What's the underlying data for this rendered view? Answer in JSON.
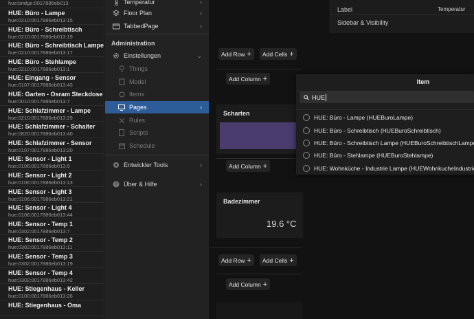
{
  "things_list": [
    {
      "title": "",
      "subtitle": "hue:bridge:0017886eb013"
    },
    {
      "title": "HUE: Büro - Lampe",
      "subtitle": "hue:0210:0017886eb013:15"
    },
    {
      "title": "HUE: Büro - Schreibtisch",
      "subtitle": "hue:0210:0017886eb013:19"
    },
    {
      "title": "HUE: Büro - Schreibtisch Lampe",
      "subtitle": "hue:0210:0017886eb013:17"
    },
    {
      "title": "HUE: Büro - Stehlampe",
      "subtitle": "hue:0210:0017886eb013:1"
    },
    {
      "title": "HUE: Eingang - Sensor",
      "subtitle": "hue:0107:0017886eb013:43"
    },
    {
      "title": "HUE: Garten - Osram Steckdose",
      "subtitle": "hue:0010:0017886eb013:7"
    },
    {
      "title": "HUE: Schlafzimmer - Lampe",
      "subtitle": "hue:0210:0017886eb013:29"
    },
    {
      "title": "HUE: Schlafzimmer - Schalter",
      "subtitle": "hue:0820:0017886eb013:40"
    },
    {
      "title": "HUE: Schlafzimmer - Sensor",
      "subtitle": "hue:0107:0017886eb013:20"
    },
    {
      "title": "HUE: Sensor - Light 1",
      "subtitle": "hue:0106:0017886eb013:9"
    },
    {
      "title": "HUE: Sensor - Light 2",
      "subtitle": "hue:0106:0017886eb013:13"
    },
    {
      "title": "HUE: Sensor - Light 3",
      "subtitle": "hue:0106:0017886eb013:21"
    },
    {
      "title": "HUE: Sensor - Light 4",
      "subtitle": "hue:0106:0017886eb013:44"
    },
    {
      "title": "HUE: Sensor - Temp 1",
      "subtitle": "hue:0302:0017886eb013:7"
    },
    {
      "title": "HUE: Sensor - Temp 2",
      "subtitle": "hue:0302:0017886eb013:11"
    },
    {
      "title": "HUE: Sensor - Temp 3",
      "subtitle": "hue:0302:0017886eb013:19"
    },
    {
      "title": "HUE: Sensor - Temp 4",
      "subtitle": "hue:0302:0017886eb013:42"
    },
    {
      "title": "HUE: Stiegenhaus - Keller",
      "subtitle": "hue:0100:0017886eb013:26"
    },
    {
      "title": "HUE: Stiegenhaus - Oma",
      "subtitle": ""
    }
  ],
  "nav": {
    "temperatur": "Temperatur",
    "floor_plan": "Floor Plan",
    "tabbed_page": "TabbedPage",
    "administration": "Administration",
    "einstellungen": "Einstellungen",
    "things": "Things",
    "model": "Model",
    "items": "Items",
    "pages": "Pages",
    "rules": "Rules",
    "scripts": "Scripts",
    "schedule": "Schedule",
    "entwickler_tools": "Entwickler Tools",
    "ueber_hilfe": "Über & Hilfe"
  },
  "editor": {
    "add_row": "Add Row",
    "add_cells": "Add Cells",
    "add_column": "Add Column",
    "scharten": "Scharten",
    "badezimmer": "Badezimmer",
    "temp_value": "19.6 °C"
  },
  "properties": {
    "label_key": "Label",
    "label_value": "Temperatur",
    "sidebar_visibility": "Sidebar & Visibility"
  },
  "dialog": {
    "title": "Item",
    "search_value": "HUE",
    "options": [
      "HUE: Büro - Lampe (HUEBuroLampe)",
      "HUE: Büro - Schreibtisch (HUEBuroSchreibtisch)",
      "HUE: Büro - Schreibtisch Lampe (HUEBuroSchreibtischLampe)",
      "HUE: Büro - Stehlampe (HUEBuroStehlampe)",
      "HUE: Wohnküche - Industrie Lampe (HUEWohnkucheIndustrieLampe)"
    ]
  },
  "colors": {
    "accent": "#2d5d99",
    "card_purple": "#4b3c70"
  }
}
